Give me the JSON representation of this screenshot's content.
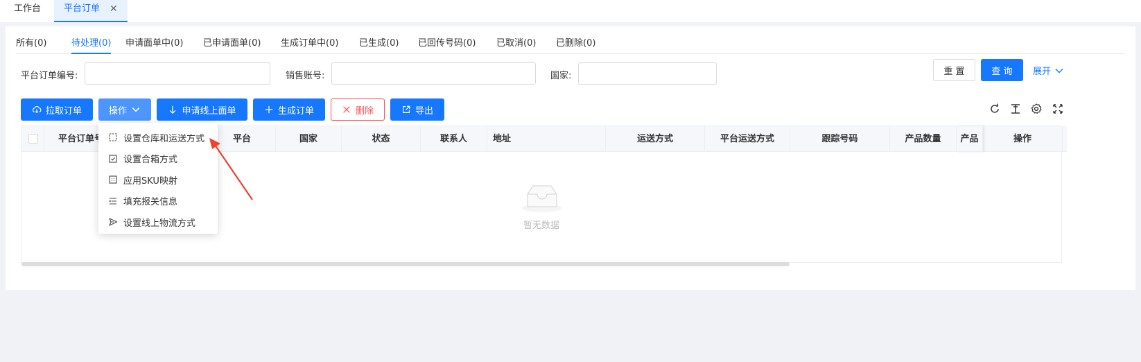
{
  "page_tabs": [
    {
      "label": "工作台"
    },
    {
      "label": "平台订单",
      "close": "✕"
    }
  ],
  "status_tabs": [
    {
      "label": "所有(0)"
    },
    {
      "label": "待处理(0)"
    },
    {
      "label": "申请面单中(0)"
    },
    {
      "label": "已申请面单(0)"
    },
    {
      "label": "生成订单中(0)"
    },
    {
      "label": "已生成(0)"
    },
    {
      "label": "已回传号码(0)"
    },
    {
      "label": "已取消(0)"
    },
    {
      "label": "已删除(0)"
    }
  ],
  "filters": {
    "order_no_label": "平台订单编号:",
    "order_no_value": "",
    "account_label": "销售账号:",
    "account_value": "",
    "country_label": "国家:",
    "country_value": "",
    "reset_label": "重 置",
    "query_label": "查 询",
    "expand_label": "展开"
  },
  "toolbar": {
    "pull_orders": "拉取订单",
    "operations": "操作",
    "apply_label": "申请线上面单",
    "generate_order": "生成订单",
    "delete": "删除",
    "export": "导出"
  },
  "table": {
    "columns": [
      "平台订单号",
      "平台",
      "国家",
      "状态",
      "联系人",
      "地址",
      "运送方式",
      "平台运送方式",
      "跟踪号码",
      "产品数量",
      "产品",
      "操作"
    ],
    "empty_text": "暂无数据"
  },
  "operations_menu": [
    {
      "label": "设置仓库和运送方式",
      "icon": "dashed-square-icon"
    },
    {
      "label": "设置合箱方式",
      "icon": "checkbox-icon"
    },
    {
      "label": "应用SKU映射",
      "icon": "grid-square-icon"
    },
    {
      "label": "填充报关信息",
      "icon": "list-icon"
    },
    {
      "label": "设置线上物流方式",
      "icon": "send-icon"
    }
  ],
  "colors": {
    "primary": "#1677ff",
    "danger": "#ff4d4f",
    "annotation_arrow": "#f0412a"
  }
}
